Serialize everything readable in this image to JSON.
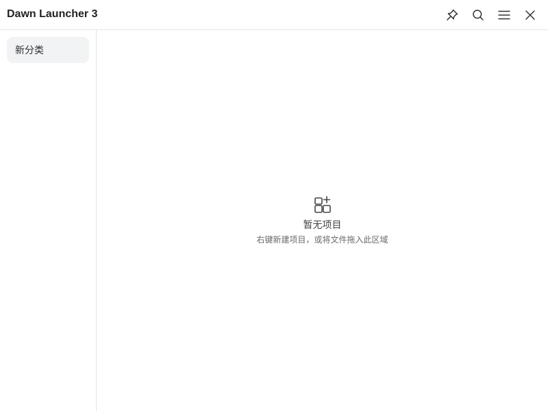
{
  "window": {
    "title": "Dawn Launcher 3"
  },
  "toolbar": {
    "pin_icon": "pin-icon",
    "search_icon": "search-icon",
    "menu_icon": "hamburger-menu-icon",
    "close_icon": "close-icon"
  },
  "sidebar": {
    "items": [
      {
        "label": "新分类",
        "selected": true
      }
    ]
  },
  "main": {
    "empty_state": {
      "icon": "add-grid-icon",
      "title": "暂无项目",
      "hint": "右键新建项目，或将文件拖入此区域"
    }
  },
  "colors": {
    "divider": "#e3e3e3",
    "selected_item_bg": "#f2f3f5",
    "icon_stroke": "#333333",
    "hint_text": "#6a6a6a"
  }
}
